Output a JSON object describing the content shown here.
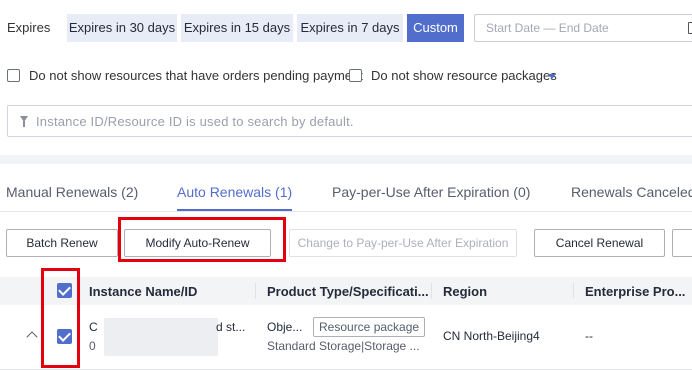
{
  "expires": {
    "label": "Expires",
    "options": [
      "Expires in 30 days",
      "Expires in 15 days",
      "Expires in 7 days",
      "Custom"
    ],
    "date_placeholder": "Start Date — End Date"
  },
  "filters": {
    "pending_payment": "Do not show resources that have orders pending payment",
    "resource_packages": "Do not show resource packages"
  },
  "search": {
    "placeholder": "Instance ID/Resource ID is used to search by default."
  },
  "tabs": [
    {
      "label": "Manual Renewals (2)"
    },
    {
      "label": "Auto Renewals (1)"
    },
    {
      "label": "Pay-per-Use After Expiration (0)"
    },
    {
      "label": "Renewals Canceled"
    }
  ],
  "actions": {
    "batch_renew": "Batch Renew",
    "modify_auto_renew": "Modify Auto-Renew",
    "change_pay_per_use": "Change to Pay-per-Use After Expiration",
    "cancel_renewal": "Cancel Renewal"
  },
  "table": {
    "headers": [
      "Instance Name/ID",
      "Product Type/Specificati...",
      "Region",
      "Enterprise Pro..."
    ],
    "rows": [
      {
        "name_prefix": "C",
        "name_suffix": "d st...",
        "id_prefix": "0",
        "product": "Obje...",
        "tag": "Resource package",
        "spec": "Standard Storage|Storage ...",
        "region": "CN North-Beijing4",
        "enterprise": "--"
      }
    ]
  },
  "colors": {
    "accent": "#526ecc",
    "highlight": "#e3000f"
  }
}
